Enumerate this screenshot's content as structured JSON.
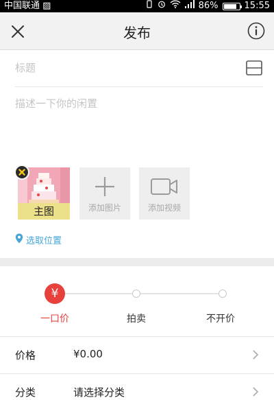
{
  "status_bar": {
    "carrier": "中国联通 ▨",
    "battery_percent": "86%",
    "battery_level": 0.86,
    "time": "15:55"
  },
  "header": {
    "title": "发布",
    "close_icon": "close-icon",
    "info_icon": "info-icon"
  },
  "form": {
    "title_placeholder": "标题",
    "description_placeholder": "描述一下你的闲置"
  },
  "media": {
    "cover_label": "主图",
    "add_image_label": "添加图片",
    "add_video_label": "添加视频"
  },
  "location": {
    "label": "选取位置"
  },
  "sale_mode": {
    "options": [
      "一口价",
      "拍卖",
      "不开价"
    ],
    "selected": "一口价",
    "selected_symbol": "¥"
  },
  "rows": {
    "price": {
      "label": "价格",
      "value": "¥0.00"
    },
    "category": {
      "label": "分类",
      "value": "请选择分类"
    }
  },
  "colors": {
    "accent_red": "#e8413b",
    "link_blue": "#47a6d8",
    "header_bg": "#f2f2f2"
  }
}
